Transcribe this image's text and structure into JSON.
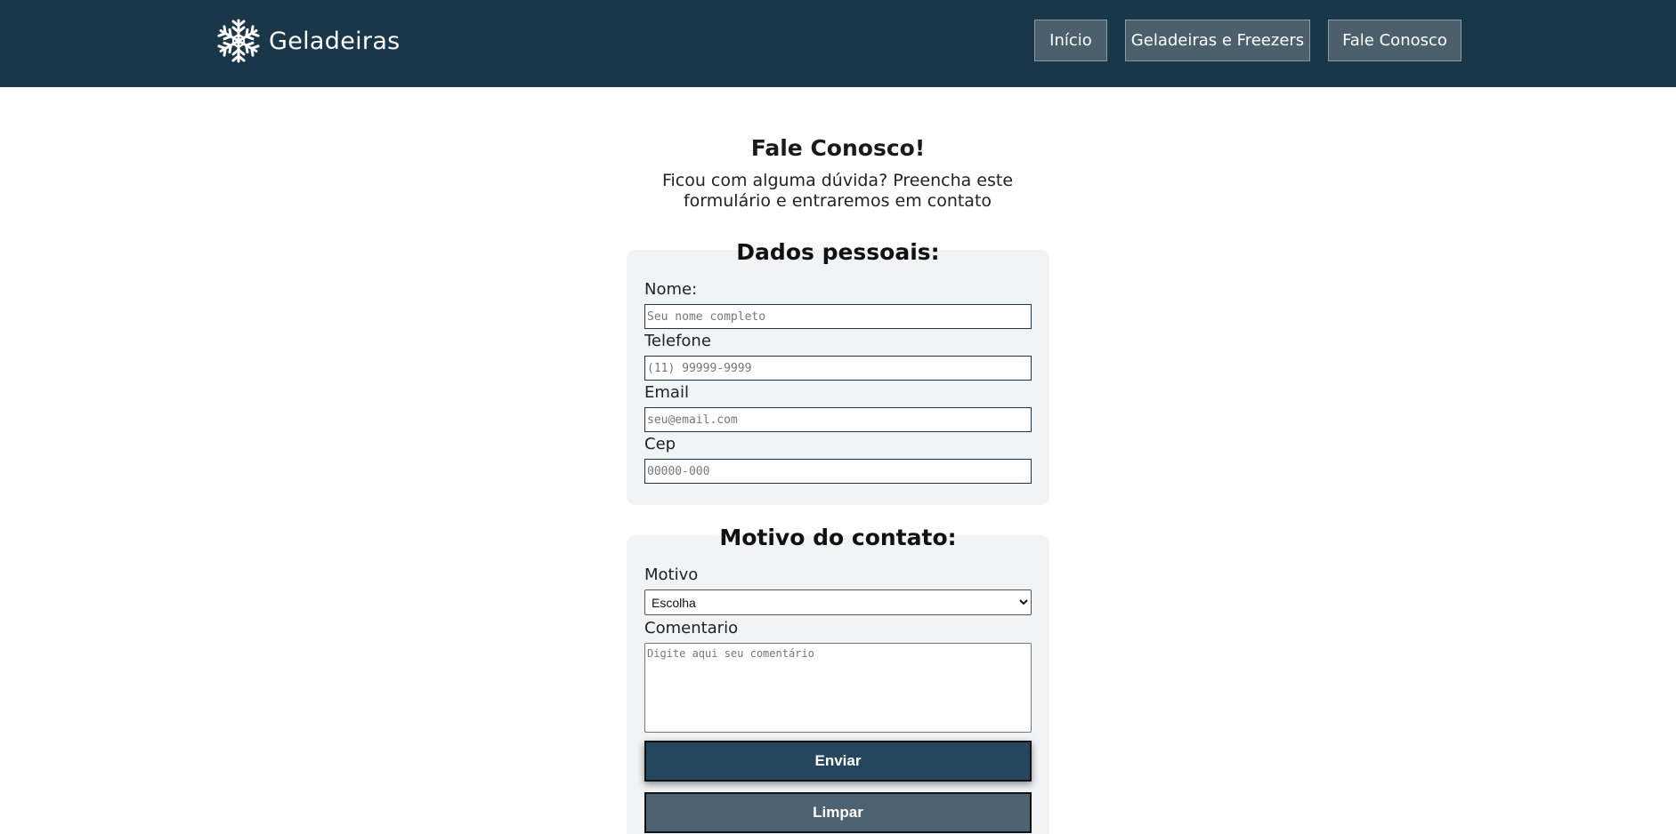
{
  "header": {
    "brand": "Geladeiras",
    "nav": [
      {
        "label": "Início"
      },
      {
        "label": "Geladeiras e Freezers"
      },
      {
        "label": "Fale Conosco"
      }
    ]
  },
  "main": {
    "title": "Fale Conosco!",
    "subtitle": "Ficou com alguma dúvida? Preencha este formulário e entraremos em contato"
  },
  "personal": {
    "heading": "Dados pessoais:",
    "name": {
      "label": "Nome:",
      "placeholder": "Seu nome completo",
      "value": ""
    },
    "phone": {
      "label": "Telefone",
      "placeholder": "(11) 99999-9999",
      "value": ""
    },
    "email": {
      "label": "Email",
      "placeholder": "seu@email.com",
      "value": ""
    },
    "cep": {
      "label": "Cep",
      "placeholder": "00000-000",
      "value": ""
    }
  },
  "contact": {
    "heading": "Motivo do contato:",
    "reason": {
      "label": "Motivo",
      "selected": "Escolha"
    },
    "comment": {
      "label": "Comentario",
      "placeholder": "Digite aqui seu comentário",
      "value": ""
    },
    "send_label": "Enviar",
    "clear_label": "Limpar"
  },
  "colors": {
    "header_bg": "#1a3649",
    "nav_button": "#4b5f6c",
    "card_bg": "#f2f3f5",
    "send_button": "#25465f",
    "clear_button": "#4d6272"
  },
  "icons": {
    "brand": "snowflake-icon"
  }
}
